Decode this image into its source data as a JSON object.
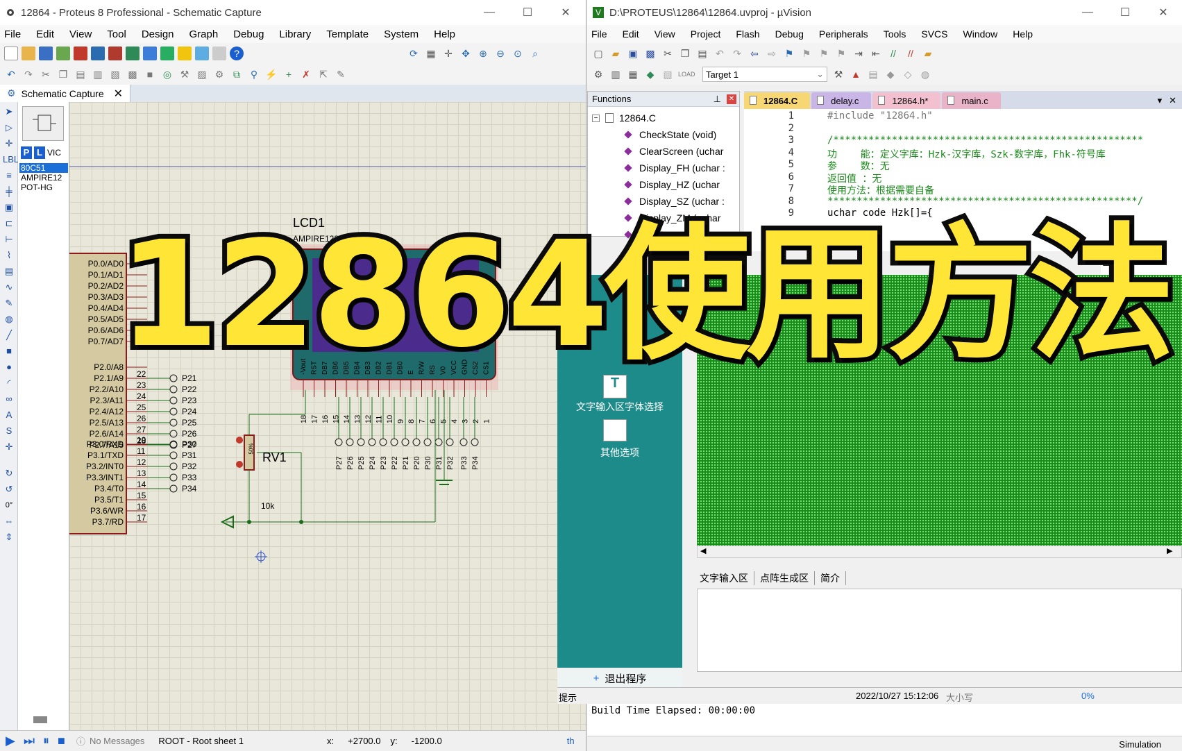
{
  "proteus": {
    "title": "12864 - Proteus 8 Professional - Schematic Capture",
    "menu": [
      "File",
      "Edit",
      "View",
      "Tool",
      "Design",
      "Graph",
      "Debug",
      "Library",
      "Template",
      "System",
      "Help"
    ],
    "tab_label": "Schematic Capture",
    "devices": [
      "80C51",
      "AMPIRE12",
      "POT-HG"
    ],
    "device_mode_buttons": [
      "P",
      "L",
      "VIC"
    ],
    "lcd_ref": "LCD1",
    "lcd_part": "AMPIRE128X64",
    "mcu_pins_left": [
      "P0.0/AD0",
      "P0.1/AD1",
      "P0.2/AD2",
      "P0.3/AD3",
      "P0.4/AD4",
      "P0.5/AD5",
      "P0.6/AD6",
      "P0.7/AD7",
      "P2.0/A8",
      "P2.1/A9",
      "P2.2/A10",
      "P2.3/A11",
      "P2.4/A12",
      "P2.5/A13",
      "P2.6/A14",
      "P2.7/A15",
      "P3.0/RXD",
      "P3.1/TXD",
      "P3.2/INT0",
      "P3.3/INT1",
      "P3.4/T0",
      "P3.5/T1",
      "P3.6/WR",
      "P3.7/RD"
    ],
    "p2_pin_numbers": [
      "22",
      "23",
      "24",
      "25",
      "26",
      "27",
      "28"
    ],
    "p2_net_labels": [
      "P21",
      "P22",
      "P23",
      "P24",
      "P25",
      "P26",
      "P27"
    ],
    "p3_pin_numbers": [
      "10",
      "11",
      "12",
      "13",
      "14",
      "15",
      "16",
      "17"
    ],
    "p3_net_labels": [
      "P30",
      "P31",
      "P32",
      "P33",
      "P34"
    ],
    "lcd_pin_names": [
      "-Vout",
      "RST",
      "DB7",
      "DB6",
      "DB5",
      "DB4",
      "DB3",
      "DB2",
      "DB1",
      "DB0",
      "E",
      "R/W",
      "RS",
      "V0",
      "VCC",
      "GND",
      "CS2",
      "CS1"
    ],
    "lcd_pin_numbers": [
      "18",
      "17",
      "16",
      "15",
      "14",
      "13",
      "12",
      "11",
      "10",
      "9",
      "8",
      "7",
      "6",
      "5",
      "4",
      "3",
      "2",
      "1"
    ],
    "lcd_net_labels": [
      "P27",
      "P26",
      "P25",
      "P24",
      "P23",
      "P22",
      "P21",
      "P20",
      "P30",
      "P31",
      "P32",
      "P33",
      "P34"
    ],
    "pot_ref": "RV1",
    "pot_value": "10k",
    "pot_pct": "50%",
    "status": {
      "messages": "No Messages",
      "sheet": "ROOT - Root sheet 1",
      "x_label": "x:",
      "x_value": "+2700.0",
      "y_label": "y:",
      "y_value": "-1200.0",
      "angle": "0°",
      "right_cut": "th"
    }
  },
  "uvision": {
    "title": "D:\\PROTEUS\\12864\\12864.uvproj - µVision",
    "menu": [
      "File",
      "Edit",
      "View",
      "Project",
      "Flash",
      "Debug",
      "Peripherals",
      "Tools",
      "SVCS",
      "Window",
      "Help"
    ],
    "target": "Target 1",
    "functions_panel_title": "Functions",
    "tree_root": "12864.C",
    "functions": [
      "CheckState (void)",
      "ClearScreen (uchar",
      "Display_FH (uchar :",
      "Display_HZ (uchar",
      "Display_SZ (uchar :",
      "Display_ZM (uchar",
      "InitLC"
    ],
    "editor_tabs": [
      "12864.C",
      "delay.c",
      "12864.h*",
      "main.c"
    ],
    "code_lines": [
      {
        "n": "1",
        "text": "#include \"12864.h\""
      },
      {
        "n": "2",
        "text": ""
      },
      {
        "n": "3",
        "text": "/*****************************************************"
      },
      {
        "n": "4",
        "text": "功    能：定义字库：Hzk-汉字库，Szk-数字库，Fhk-符号库"
      },
      {
        "n": "5",
        "text": "参    数：无"
      },
      {
        "n": "6",
        "text": "返回值 ：无"
      },
      {
        "n": "7",
        "text": "使用方法：根据需要自备"
      },
      {
        "n": "8",
        "text": "*****************************************************/"
      },
      {
        "n": "9",
        "text": "uchar code Hzk[]={"
      }
    ],
    "build_output": "Build Time Elapsed:  00:00:00",
    "status_right": "Simulation"
  },
  "fonttool": {
    "side_items": [
      "文字输入区字体选择",
      "其他选项"
    ],
    "exit_label": "退出程序",
    "tabs": [
      "文字输入区",
      "点阵生成区",
      "简介"
    ],
    "hint_label": "提示",
    "datetime": "2022/10/27 15:12:06",
    "caps": "大小写",
    "progress": "0%"
  },
  "headline": "12864使用方法",
  "colors": {
    "headline": "#ffe535",
    "lcd_body": "#1f6b6b",
    "lcd_screen": "#4b2b8c",
    "dot_matrix": "#0f8f1d",
    "tool_side": "#1d8b8a"
  }
}
